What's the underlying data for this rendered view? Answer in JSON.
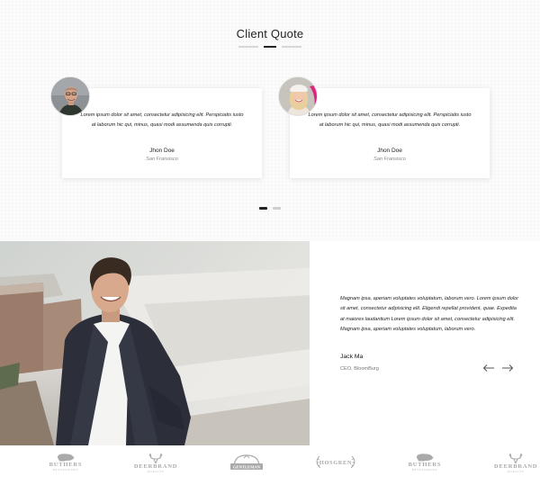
{
  "quote_section": {
    "title": "Client Quote",
    "cards": [
      {
        "quote": "Lorem ipsum dolor sit amet, consectetur adipisicing elit. Perspiciatis iusto at laborum hic qui, minus, quasi modi assumenda quis corrupti.",
        "name": "Jhon Doe",
        "location": "San Fransisco"
      },
      {
        "quote": "Lorem ipsum dolor sit amet, consectetur adipisicing elit. Perspiciatis iusto at laborum hic qui, minus, quasi modi assumenda quis corrupti.",
        "name": "Jhon Doe",
        "location": "San Fransisco"
      }
    ],
    "active_slide": 1,
    "slide_count": 2
  },
  "testimonial": {
    "quote": "Magnam ipsa, aperiam voluptates voluptatum, laborum vero. Lorem ipsum dolor sit amet, consectetur adipisicing elit. Eligendi repellat provident, quae. Expedita at maiores laudantium Lorem ipsum dolor sit amet, consectetur adipisicing elit. Magnam ipsa, aperiam voluptates voluptatum, laborum vero.",
    "name": "Jack Ma",
    "role": "CEO, BloomBurg",
    "prev_icon": "arrow-left-icon",
    "next_icon": "arrow-right-icon"
  },
  "brands": [
    {
      "name": "BUTHERS",
      "sub": "RESTAURANT",
      "icon": "pig-icon"
    },
    {
      "name": "DEERBRAND",
      "sub": "QUALITY",
      "icon": "deer-icon"
    },
    {
      "name": "GENTLEMAN",
      "sub": "",
      "icon": "badge-icon"
    },
    {
      "name": "HOSGREN",
      "sub": "",
      "icon": "wreath-icon"
    },
    {
      "name": "BUTHERS",
      "sub": "RESTAURANT",
      "icon": "pig-icon"
    },
    {
      "name": "DEERBRAND",
      "sub": "QUALITY",
      "icon": "deer-icon"
    }
  ],
  "colors": {
    "accent": "#222222",
    "muted": "#a9a9a9",
    "background": "#fbfbfb"
  }
}
